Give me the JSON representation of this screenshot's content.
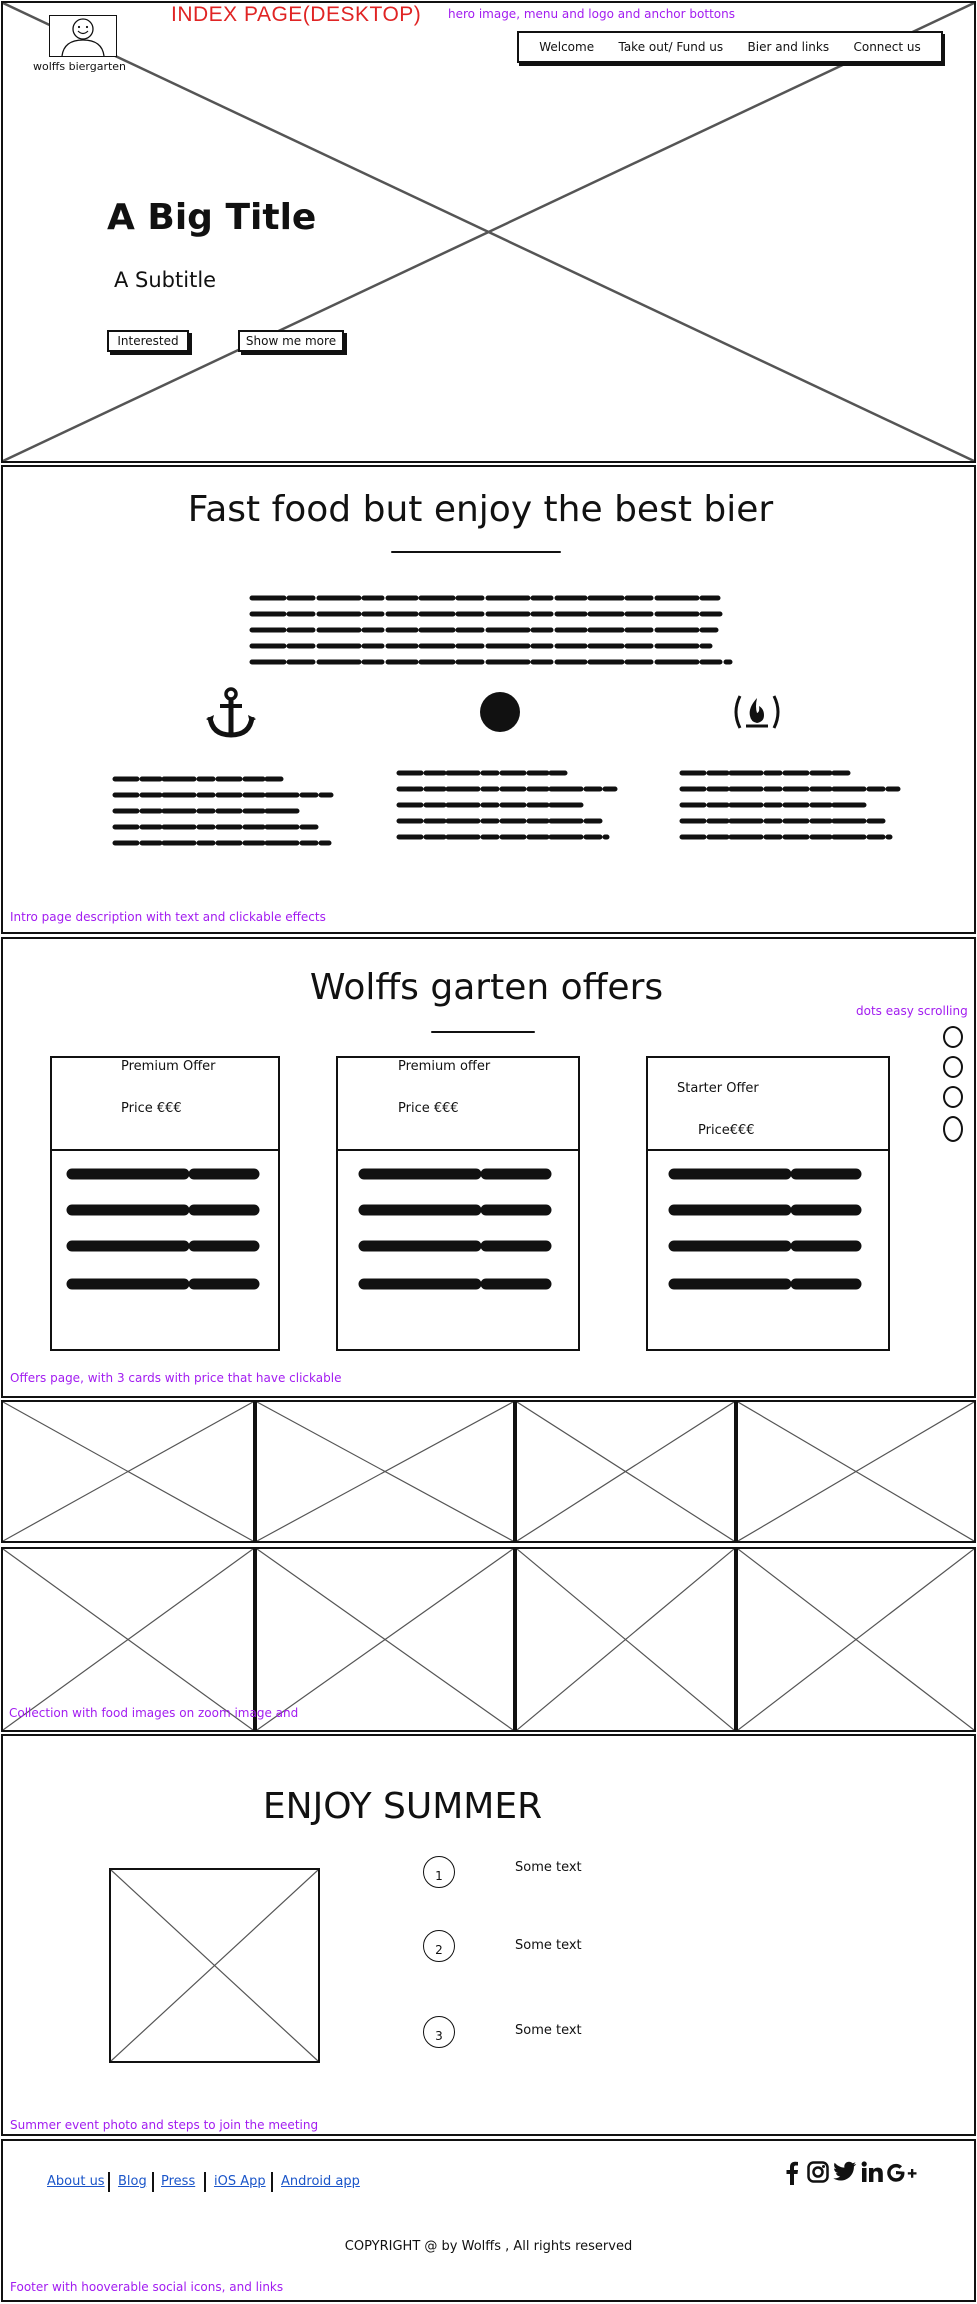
{
  "hero": {
    "page_title": "INDEX PAGE(DESKTOP)",
    "annotation": "hero image, menu and logo and anchor bottons",
    "logo_text": "wolffs biergarten",
    "nav": [
      "Welcome",
      "Take out/ Fund us",
      "Bier and links",
      "Connect us"
    ],
    "title": "A Big Title",
    "subtitle": "A Subtitle",
    "buttons": {
      "interested": "Interested",
      "show_more": "Show me more"
    }
  },
  "intro": {
    "heading": "Fast food but enjoy the best bier",
    "icons": [
      "anchor-icon",
      "circle-icon",
      "freecodecamp-icon"
    ],
    "annotation": "Intro page description with text and clickable effects"
  },
  "offers": {
    "heading": "Wolffs garten offers",
    "dots_annotation": "dots easy scrolling",
    "cards": [
      {
        "name": "Premium Offer",
        "price": "Price €€€"
      },
      {
        "name": "Premium offer",
        "price": "Price €€€"
      },
      {
        "name": "Starter Offer",
        "price": "Price€€€"
      }
    ],
    "annotation": "Offers page, with 3 cards with price that have clickable"
  },
  "gallery": {
    "annotation": "Collection with food images on zoom image and"
  },
  "summer": {
    "heading": "ENJOY SUMMER",
    "steps": [
      {
        "number": "1",
        "text": "Some text"
      },
      {
        "number": "2",
        "text": "Some text"
      },
      {
        "number": "3",
        "text": "Some text"
      }
    ],
    "annotation": "Summer event photo and steps to join the meeting"
  },
  "footer": {
    "links": [
      "About us",
      "Blog",
      "Press",
      "iOS App",
      "Android app"
    ],
    "social_icons": [
      "facebook-icon",
      "instagram-icon",
      "twitter-icon",
      "linkedin-icon",
      "google-plus-icon"
    ],
    "copyright": "COPYRIGHT @ by Wolffs , All rights reserved",
    "annotation": "Footer with hooverable social icons, and links"
  },
  "colors": {
    "annotation": "#a21cf0",
    "page_title": "#e02424",
    "link": "#1a55c9"
  }
}
